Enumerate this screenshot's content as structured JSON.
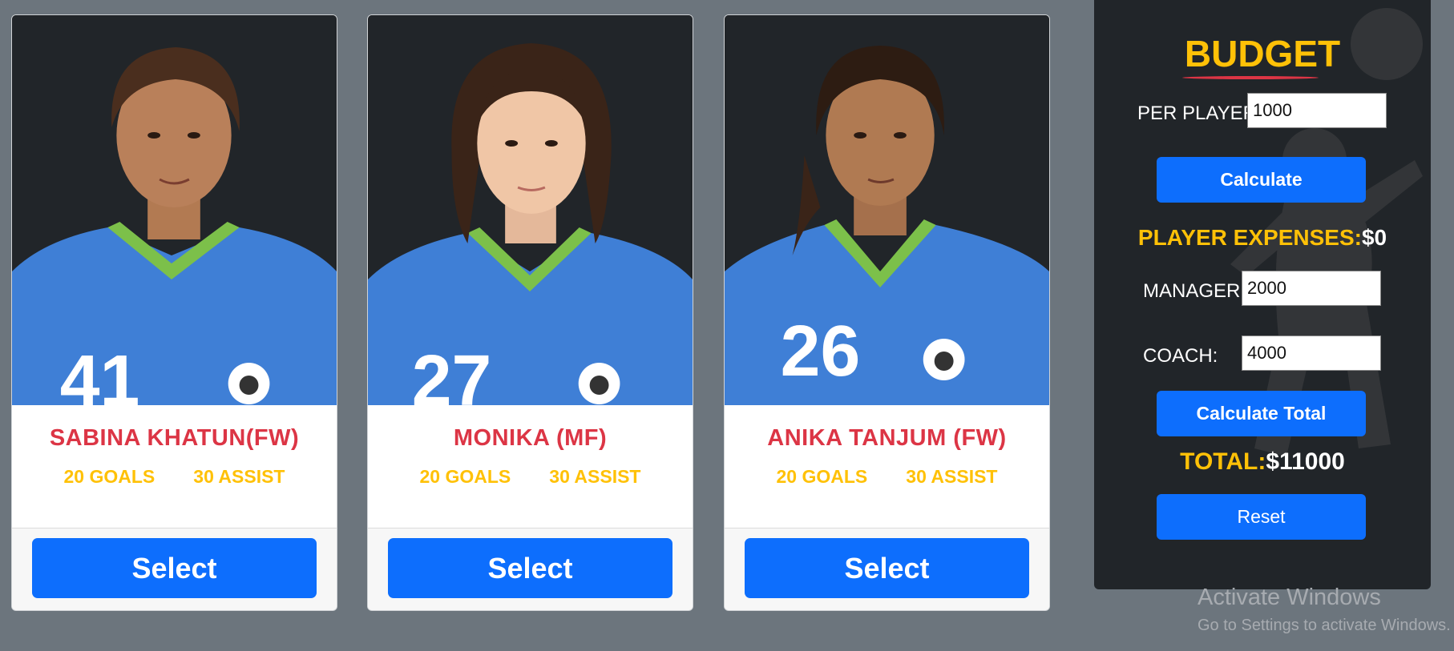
{
  "players": [
    {
      "name": "SABINA KHATUN(FW)",
      "goals": "20 GOALS",
      "assist": "30 ASSIST",
      "jersey": "41",
      "select_label": "Select"
    },
    {
      "name": "MONIKA (MF)",
      "goals": "20 GOALS",
      "assist": "30 ASSIST",
      "jersey": "27",
      "select_label": "Select"
    },
    {
      "name": "ANIKA TANJUM (FW)",
      "goals": "20 GOALS",
      "assist": "30 ASSIST",
      "jersey": "26",
      "select_label": "Select"
    }
  ],
  "budget": {
    "title": "BUDGET",
    "per_player_label": "PER PLAYER:",
    "per_player_value": "1000",
    "calculate_label": "Calculate",
    "player_expenses_label": "PLAYER EXPENSES:",
    "player_expenses_value": "$0",
    "manager_label": "MANAGER:",
    "manager_value": "2000",
    "coach_label": "COACH:",
    "coach_value": "4000",
    "calculate_total_label": "Calculate Total",
    "total_label": "TOTAL:",
    "total_value": "$11000",
    "reset_label": "Reset"
  },
  "watermark": {
    "line1": "Activate Windows",
    "line2": "Go to Settings to activate Windows."
  },
  "colors": {
    "page_bg": "#6c757d",
    "panel_bg": "#212529",
    "primary": "#0d6efd",
    "name_red": "#dc3545",
    "accent_yellow": "#ffc107",
    "jersey_blue": "#3f7fd6",
    "collar_green": "#7cc04a"
  }
}
